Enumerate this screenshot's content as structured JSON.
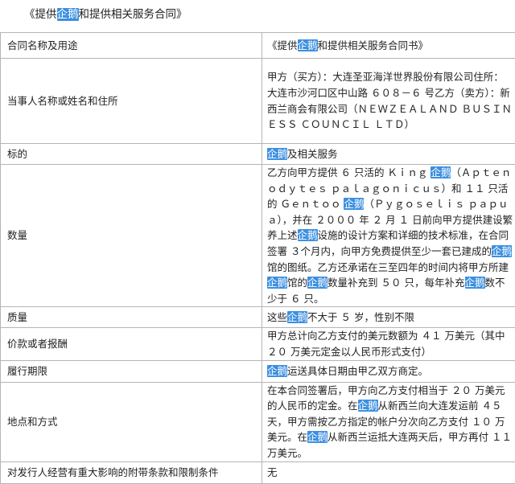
{
  "document": {
    "title_prefix": "《提供",
    "title_highlight": "企鹅",
    "title_suffix": "和提供相关服务合同》"
  },
  "rows": [
    {
      "label": "合同名称及用途",
      "value": [
        {
          "t": "《提供"
        },
        {
          "t": "企鹅",
          "hl": true
        },
        {
          "t": "和提供相关服务合同书》"
        }
      ]
    },
    {
      "label": "当事人名称或姓名和住所",
      "value": [
        {
          "t": "甲方（买方）：大连圣亚海洋世界股份有限公司住所：大连市沙河口区中山路 ６０８－６ 号乙方（卖方）：新西兰商会有限公司（ＮＥＷＺＥＡＬＡＮＤ ＢＵＳＩＮＥＳＳ ＣＯＵＮＣＩＬ ＬＴＤ）"
        }
      ]
    },
    {
      "label": "标的",
      "value": [
        {
          "t": "企鹅",
          "hl": true
        },
        {
          "t": "及相关服务"
        }
      ]
    },
    {
      "label": "数量",
      "value": [
        {
          "t": "乙方向甲方提供 ６ 只活的 Ｋｉｎｇ "
        },
        {
          "t": "企鹅",
          "hl": true
        },
        {
          "t": "（Ａｐｔｅｎｏｄｙｔｅｓ ｐａｌａｇｏｎｉｃｕｓ）和 １１ 只活的 Ｇｅｎｔｏｏ "
        },
        {
          "t": "企鹅",
          "hl": true
        },
        {
          "t": "（Ｐｙｇｏｓｅｌｉｓ ｐａｐｕａ），并在 ２０００ 年 ２ 月 １ 日前向甲方提供建设繁养上述"
        },
        {
          "t": "企鹅",
          "hl": true
        },
        {
          "t": "设施的设计方案和详细的技术标准，在合同签署 ３个月内，向甲方免费提供至少一套已建成的"
        },
        {
          "t": "企鹅",
          "hl": true
        },
        {
          "t": "馆的图纸。乙方还承诺在三至四年的时间内将甲方所建"
        },
        {
          "t": "企鹅",
          "hl": true
        },
        {
          "t": "馆的"
        },
        {
          "t": "企鹅",
          "hl": true
        },
        {
          "t": "数量补充到 ５０ 只，每年补充"
        },
        {
          "t": "企鹅",
          "hl": true
        },
        {
          "t": "数不少于 ６ 只。"
        }
      ]
    },
    {
      "label": "质量",
      "value": [
        {
          "t": "这些"
        },
        {
          "t": "企鹅",
          "hl": true
        },
        {
          "t": "不大于 ５ 岁，性别不限"
        }
      ]
    },
    {
      "label": "价款或者报酬",
      "value": [
        {
          "t": "甲方总计向乙方支付的美元数额为 ４１ 万美元（其中 ２０ 万美元定金以人民币形式支付）"
        }
      ]
    },
    {
      "label": "履行期限",
      "value": [
        {
          "t": "企鹅",
          "hl": true
        },
        {
          "t": "运送具体日期由甲乙双方商定。"
        }
      ]
    },
    {
      "label": "地点和方式",
      "value": [
        {
          "t": "在本合同签署后，甲方向乙方支付相当于 ２０ 万美元的人民币的定金。在"
        },
        {
          "t": "企鹅",
          "hl": true
        },
        {
          "t": "从新西兰向大连发运前 ４５ 天，甲方需按乙方指定的帐户分次向乙方支付 １０ 万美元。在"
        },
        {
          "t": "企鹅",
          "hl": true
        },
        {
          "t": "从新西兰运抵大连两天后，甲方再付 １１ 万美元。"
        }
      ]
    },
    {
      "label": "对发行人经营有重大影响的附带条款和限制条件",
      "value": [
        {
          "t": "无"
        }
      ]
    }
  ]
}
